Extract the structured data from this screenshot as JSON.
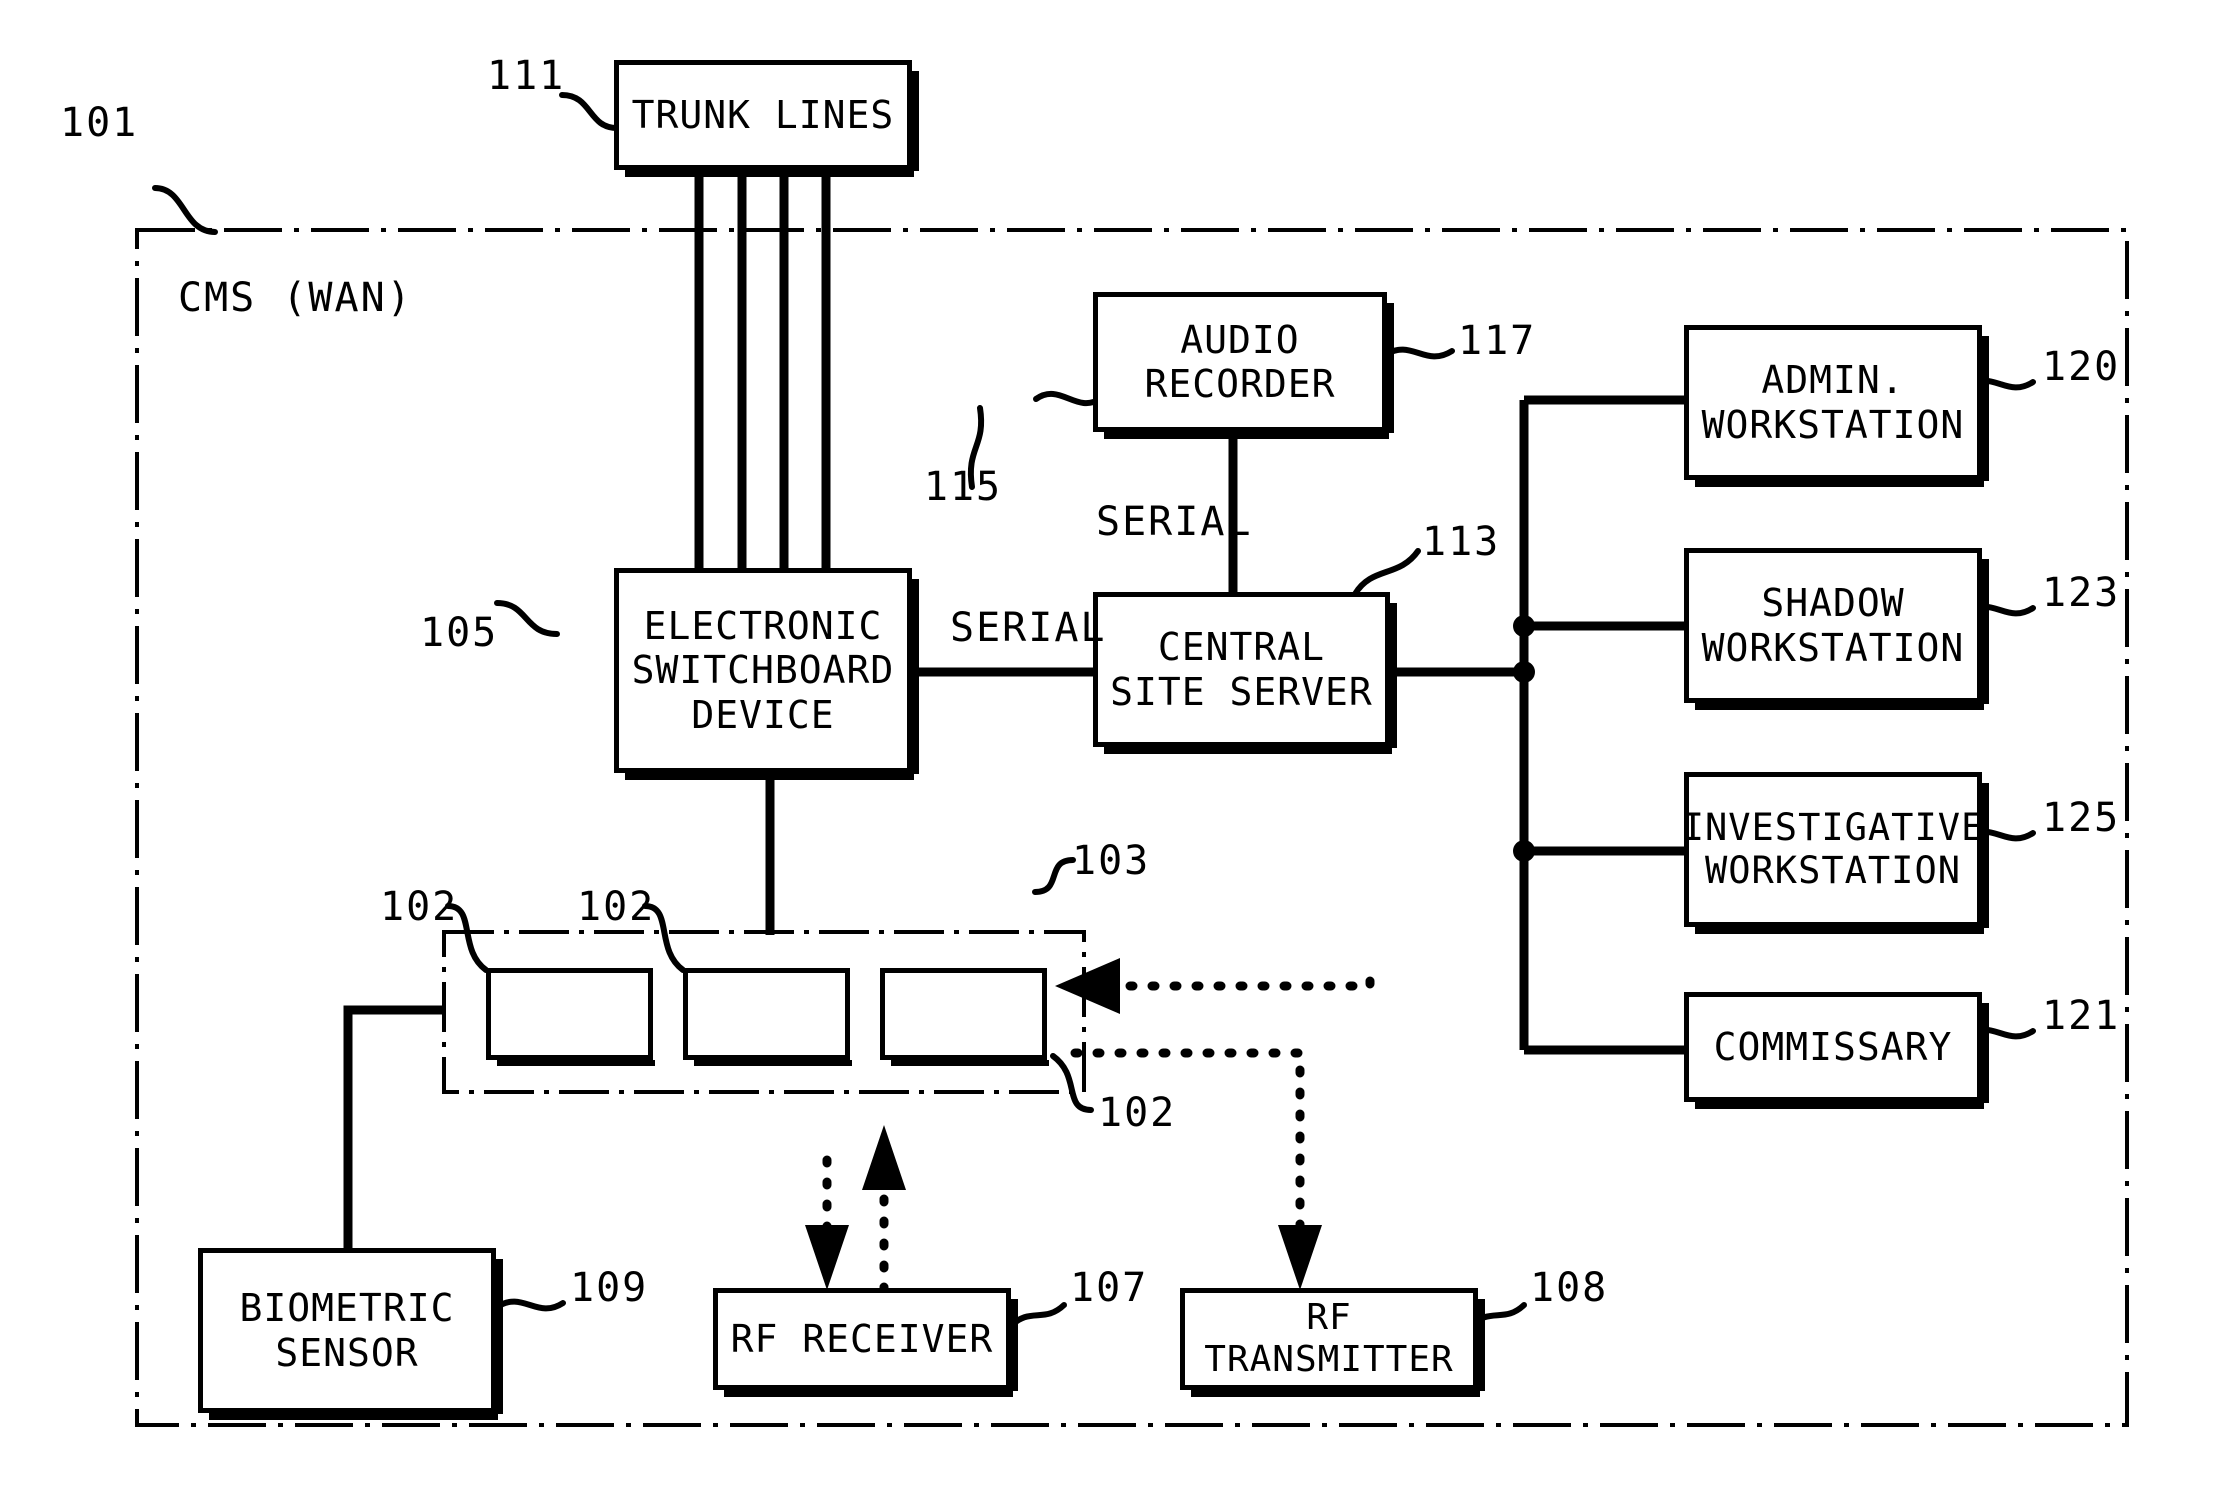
{
  "figure": {
    "system_label": "CMS (WAN)",
    "system_ref": "101"
  },
  "nodes": [
    {
      "id": "trunk-lines",
      "label": "TRUNK LINES",
      "ref": "111"
    },
    {
      "id": "electronic-switchboard-device",
      "label": "ELECTRONIC\nSWITCHBOARD\nDEVICE",
      "ref": "105"
    },
    {
      "id": "audio-recorder",
      "label": "AUDIO\nRECORDER",
      "ref": "117"
    },
    {
      "id": "central-site-server",
      "label": "CENTRAL\nSITE SERVER",
      "ref": "113"
    },
    {
      "id": "admin-workstation",
      "label": "ADMIN.\nWORKSTATION",
      "ref": "120"
    },
    {
      "id": "shadow-workstation",
      "label": "SHADOW\nWORKSTATION",
      "ref": "123"
    },
    {
      "id": "investigative-workstation",
      "label": "INVESTIGATIVE\nWORKSTATION",
      "ref": "125"
    },
    {
      "id": "commissary",
      "label": "COMMISSARY",
      "ref": "121"
    },
    {
      "id": "biometric-sensor",
      "label": "BIOMETRIC\nSENSOR",
      "ref": "109"
    },
    {
      "id": "rf-receiver",
      "label": "RF RECEIVER",
      "ref": "107"
    },
    {
      "id": "rf-transmitter",
      "label": "RF TRANSMITTER",
      "ref": "108"
    }
  ],
  "link_labels": {
    "serial_upper": "SERIAL",
    "serial_lower": "SERIAL",
    "serial_ref": "115"
  },
  "terminal_group": {
    "enclosure_ref": "103",
    "terminal_refs": [
      "102",
      "102",
      "102"
    ]
  }
}
